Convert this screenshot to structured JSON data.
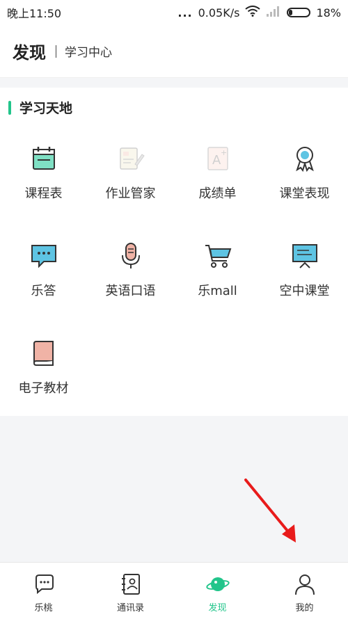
{
  "status": {
    "time": "晚上11:50",
    "dots": "...",
    "speed": "0.05K/s",
    "battery": "18%"
  },
  "header": {
    "title": "发现",
    "subtitle": "学习中心"
  },
  "section": {
    "title": "学习天地",
    "accent": "#22c58b",
    "items": [
      {
        "label": "课程表",
        "icon": "calendar-icon"
      },
      {
        "label": "作业管家",
        "icon": "homework-icon"
      },
      {
        "label": "成绩单",
        "icon": "grade-sheet-icon"
      },
      {
        "label": "课堂表现",
        "icon": "award-icon"
      },
      {
        "label": "乐答",
        "icon": "chat-bubble-icon"
      },
      {
        "label": "英语口语",
        "icon": "microphone-icon"
      },
      {
        "label": "乐mall",
        "icon": "shopping-cart-icon"
      },
      {
        "label": "空中课堂",
        "icon": "presentation-screen-icon"
      },
      {
        "label": "电子教材",
        "icon": "book-icon"
      }
    ]
  },
  "tabs": [
    {
      "label": "乐桃",
      "icon": "chat-icon"
    },
    {
      "label": "通讯录",
      "icon": "contacts-icon"
    },
    {
      "label": "发现",
      "icon": "planet-icon",
      "active": true
    },
    {
      "label": "我的",
      "icon": "user-icon"
    }
  ]
}
